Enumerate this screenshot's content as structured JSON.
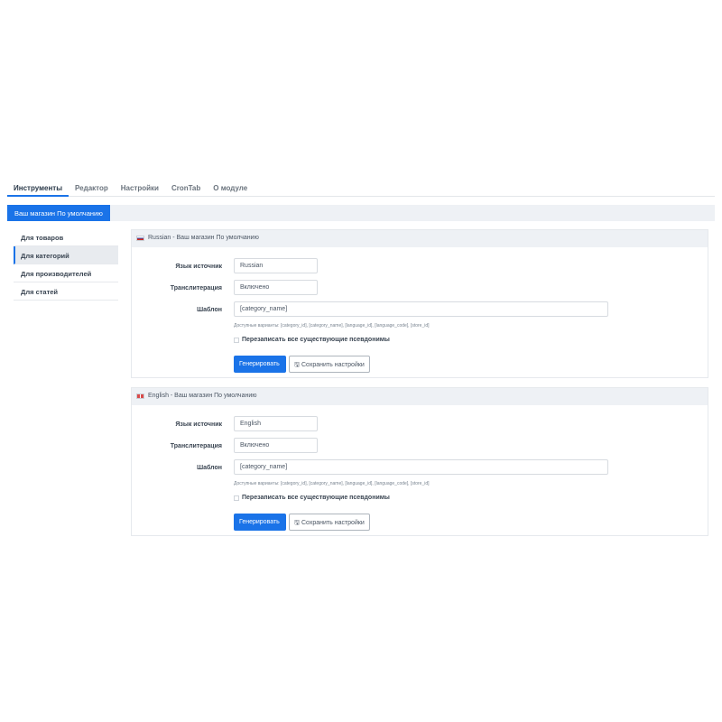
{
  "tabs": [
    {
      "label": "Инструменты"
    },
    {
      "label": "Редактор"
    },
    {
      "label": "Настройки"
    },
    {
      "label": "CronTab"
    },
    {
      "label": "О модуле"
    }
  ],
  "store": {
    "label": "Ваш магазин По умолчанию"
  },
  "sidebar": {
    "items": [
      {
        "label": "Для товаров"
      },
      {
        "label": "Для категорий"
      },
      {
        "label": "Для производителей"
      },
      {
        "label": "Для статей"
      }
    ]
  },
  "panels": [
    {
      "title": "Russian - Ваш магазин По умолчанию",
      "flag_icon": "flag-ru-icon",
      "source_lang_label": "Язык источник",
      "source_lang_value": "Russian",
      "translit_label": "Транслитерация",
      "translit_value": "Включено",
      "template_label": "Шаблон",
      "template_value": "[category_name]",
      "hint": "Доступные варианты: [category_id], [category_name], [language_id], [language_code], [store_id]",
      "overwrite_label": "Перезаписать все существующие псевдонимы",
      "generate_label": "Генерировать",
      "save_label": "Сохранить настройки"
    },
    {
      "title": "English - Ваш магазин По умолчанию",
      "flag_icon": "flag-en-icon",
      "source_lang_label": "Язык источник",
      "source_lang_value": "English",
      "translit_label": "Транслитерация",
      "translit_value": "Включено",
      "template_label": "Шаблон",
      "template_value": "[category_name]",
      "hint": "Доступные варианты: [category_id], [category_name], [language_id], [language_code], [store_id]",
      "overwrite_label": "Перезаписать все существующие псевдонимы",
      "generate_label": "Генерировать",
      "save_label": "Сохранить настройки"
    }
  ],
  "colors": {
    "accent": "#1a73e8",
    "panel_header": "#eef1f5"
  }
}
